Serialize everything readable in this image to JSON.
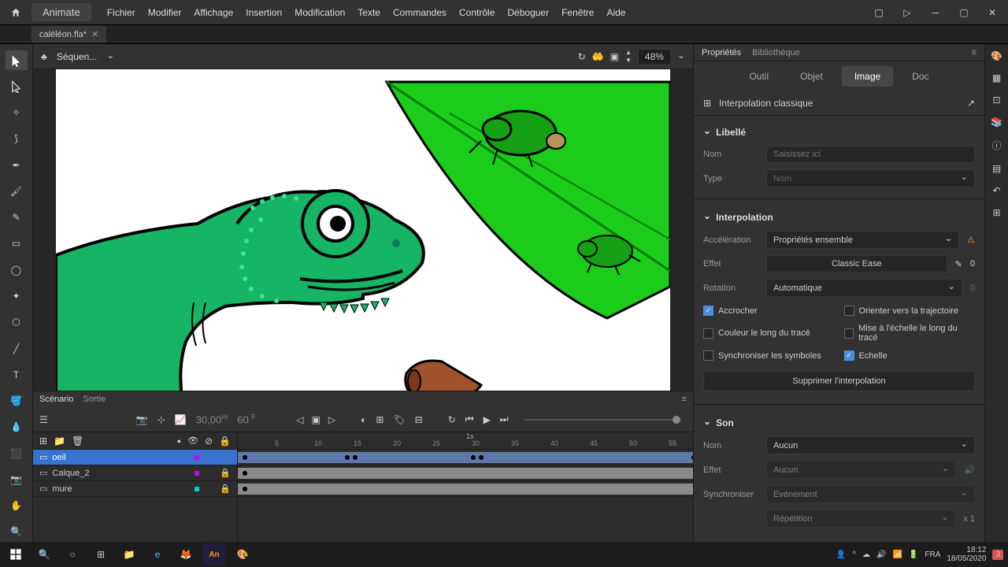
{
  "app": {
    "name": "Animate"
  },
  "menu": [
    "Fichier",
    "Modifier",
    "Affichage",
    "Insertion",
    "Modification",
    "Texte",
    "Commandes",
    "Contrôle",
    "Déboguer",
    "Fenêtre",
    "Aide"
  ],
  "tab": {
    "name": "caléléon.fla*"
  },
  "scene": {
    "name": "Séquen...",
    "zoom": "48%"
  },
  "timeline": {
    "tabs": [
      "Scénario",
      "Sortie"
    ],
    "time": "30,00",
    "time_unit": "i/s",
    "fps": "60",
    "fps_unit": "F",
    "ruler_marks": [
      "5",
      "10",
      "15",
      "20",
      "25",
      "30",
      "35",
      "40",
      "45",
      "50",
      "55"
    ],
    "ruler_sec": "1s",
    "layers": [
      {
        "name": "oeil",
        "selected": true,
        "locked": false,
        "color": "#cc00ff"
      },
      {
        "name": "Calque_2",
        "selected": false,
        "locked": true,
        "color": "#cc00ff"
      },
      {
        "name": "mure",
        "selected": false,
        "locked": true,
        "color": "#00cccc"
      }
    ]
  },
  "properties": {
    "main_tabs": [
      "Propriétés",
      "Bibliothèque"
    ],
    "sub_tabs": [
      "Outil",
      "Objet",
      "Image",
      "Doc"
    ],
    "interpolation_name": "Interpolation classique",
    "sections": {
      "label": {
        "title": "Libellé",
        "name_label": "Nom",
        "name_placeholder": "Saisissez ici",
        "type_label": "Type",
        "type_value": "Nom"
      },
      "interpolation": {
        "title": "Interpolation",
        "accel_label": "Accélération",
        "accel_value": "Propriétés ensemble",
        "effect_label": "Effet",
        "effect_value": "Classic Ease",
        "effect_num": "0",
        "rotation_label": "Rotation",
        "rotation_value": "Automatique",
        "rotation_num": "0",
        "chk_accrocher": "Accrocher",
        "chk_orienter": "Orienter vers la trajectoire",
        "chk_couleur": "Couleur le long du tracé",
        "chk_echelle_trace": "Mise à l'échelle le long du tracé",
        "chk_sync": "Synchroniser les symboles",
        "chk_echelle": "Echelle",
        "btn_delete": "Supprimer l'interpolation"
      },
      "sound": {
        "title": "Son",
        "name_label": "Nom",
        "name_value": "Aucun",
        "effect_label": "Effet",
        "effect_value": "Aucun",
        "sync_label": "Synchroniser",
        "sync_value": "Evénement",
        "repeat_value": "Répétition",
        "repeat_num": "x 1"
      }
    }
  },
  "taskbar": {
    "lang": "FRA",
    "time": "18:12",
    "date": "18/05/2020",
    "notif": "3"
  }
}
